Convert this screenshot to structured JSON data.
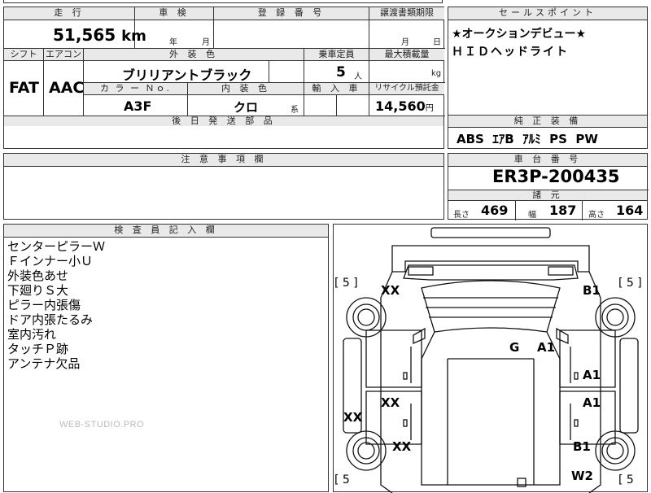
{
  "top_row": {
    "mileage_header": "走 行",
    "mileage_value": "51,565",
    "mileage_unit": "km",
    "inspection_header": "車 検",
    "inspection_year_label": "年",
    "inspection_month_label": "月",
    "registration_header": "登 録 番 号",
    "transfer_header": "譲渡書類期限",
    "transfer_month_label": "月",
    "transfer_day_label": "日"
  },
  "middle_row": {
    "shift_header": "シフト",
    "shift_value": "FAT",
    "aircon_header": "エアコン",
    "aircon_value": "AAC",
    "exterior_color_header": "外 装 色",
    "exterior_color_value": "ブリリアントブラック",
    "capacity_header": "乗車定員",
    "capacity_value": "5",
    "capacity_unit": "人",
    "max_load_header": "最大積載量",
    "max_load_unit": "kg",
    "color_no_header": "カ ラ ー Ｎｏ.",
    "color_no_value": "A3F",
    "interior_color_header": "内 装 色",
    "interior_color_value": "クロ",
    "interior_color_suffix": "系",
    "import_header": "輸 入 車",
    "recycle_header": "リサイクル預託金",
    "recycle_value": "14,560",
    "recycle_unit": "円",
    "post_shipping_header": "後 日 発 送 部 品"
  },
  "sales_points": {
    "header": "セールスポイント",
    "lines": [
      "★オークションデビュー★",
      "ＨＩＤヘッドライト"
    ]
  },
  "genuine_equipment": {
    "header": "純 正 装 備",
    "value": "ABS  ｴｱB  ｱﾙﾐ  PS  PW"
  },
  "caution": {
    "header": "注 意 事 項 欄"
  },
  "chassis": {
    "header": "車 台 番 号",
    "value": "ER3P-200435",
    "specs_header": "諸 元",
    "length_label": "長さ",
    "length_value": "469",
    "width_label": "幅",
    "width_value": "187",
    "height_label": "高さ",
    "height_value": "164"
  },
  "inspector": {
    "header": "検 査 員 記 入 欄",
    "notes": [
      "センターピラーＷ",
      "Ｆインナー小Ｕ",
      "外装色あせ",
      "下廻りＳ大",
      "ピラー内張傷",
      "ドア内張たるみ",
      "室内汚れ",
      "タッチＰ跡",
      "アンテナ欠品"
    ]
  },
  "watermark": "WEB-STUDIO.PRO",
  "diagram": {
    "tire_left_front": "[ 5 ]",
    "tire_right_front": "[ 5 ]",
    "tire_left_rear": "[ 5",
    "tire_right_rear": "[ 5",
    "marks": {
      "front_left": "XX",
      "front_right": "B1",
      "roof_g": "G",
      "pillar_right": "A1",
      "front_door_right": "A1",
      "rear_door_left": "XX",
      "rear_door_right": "A1",
      "side_left": "XX",
      "rear_fender_left": "XX",
      "rear_fender_right": "B1",
      "rear_right": "W2"
    }
  }
}
